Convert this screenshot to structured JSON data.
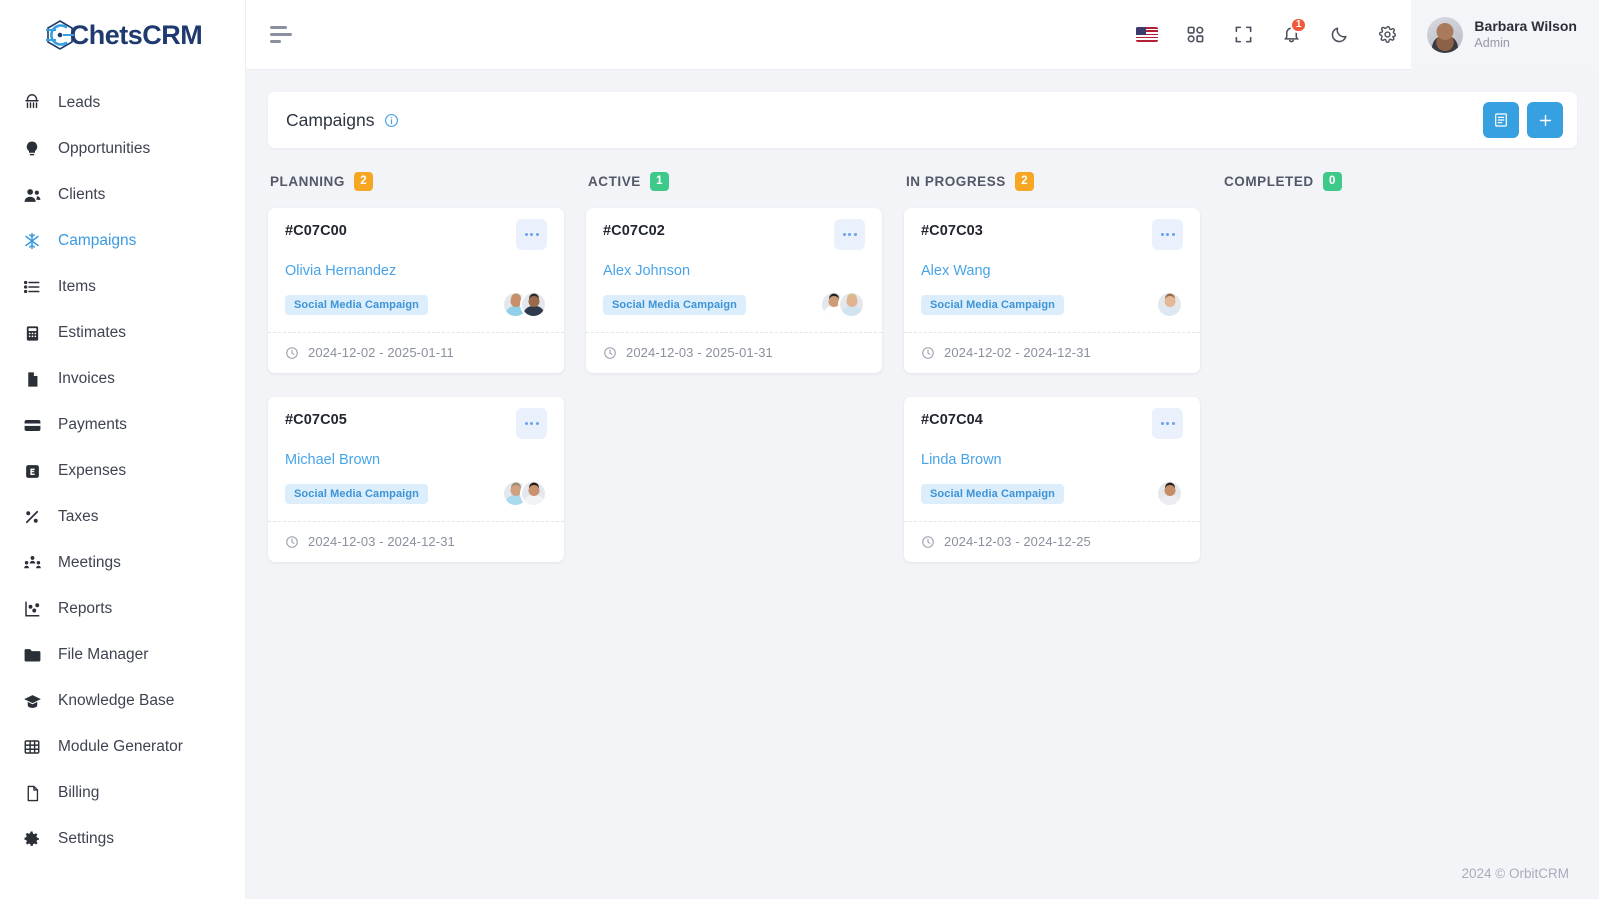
{
  "brand": {
    "name": "ChetsCRM",
    "logo_icon": "chets-logo-icon",
    "accent": "#36a0e0"
  },
  "sidebar": {
    "items": [
      {
        "label": "Leads",
        "icon": "leads-icon",
        "active": false
      },
      {
        "label": "Opportunities",
        "icon": "opportunities-icon",
        "active": false
      },
      {
        "label": "Clients",
        "icon": "clients-icon",
        "active": false
      },
      {
        "label": "Campaigns",
        "icon": "campaigns-icon",
        "active": true
      },
      {
        "label": "Items",
        "icon": "items-icon",
        "active": false
      },
      {
        "label": "Estimates",
        "icon": "estimates-icon",
        "active": false
      },
      {
        "label": "Invoices",
        "icon": "invoices-icon",
        "active": false
      },
      {
        "label": "Payments",
        "icon": "payments-icon",
        "active": false
      },
      {
        "label": "Expenses",
        "icon": "expenses-icon",
        "active": false
      },
      {
        "label": "Taxes",
        "icon": "taxes-icon",
        "active": false
      },
      {
        "label": "Meetings",
        "icon": "meetings-icon",
        "active": false
      },
      {
        "label": "Reports",
        "icon": "reports-icon",
        "active": false
      },
      {
        "label": "File Manager",
        "icon": "folder-icon",
        "active": false
      },
      {
        "label": "Knowledge Base",
        "icon": "graduation-cap-icon",
        "active": false
      },
      {
        "label": "Module Generator",
        "icon": "grid-table-icon",
        "active": false
      },
      {
        "label": "Billing",
        "icon": "billing-icon",
        "active": false
      },
      {
        "label": "Settings",
        "icon": "gear-icon",
        "active": false
      }
    ]
  },
  "topbar": {
    "menu_toggle_icon": "hamburger-icon",
    "language_flag": "us-flag-icon",
    "apps_icon": "apps-grid-icon",
    "fullscreen_icon": "fullscreen-icon",
    "notifications_icon": "bell-icon",
    "notifications_count": "1",
    "dark_mode_icon": "moon-icon",
    "settings_icon": "gear-icon",
    "user": {
      "name": "Barbara Wilson",
      "role": "Admin",
      "avatar": "user-avatar"
    }
  },
  "page": {
    "title": "Campaigns",
    "info_icon": "info-circle-icon",
    "actions": [
      {
        "name": "list-view-button",
        "icon": "list-view-icon",
        "glyph": "▤"
      },
      {
        "name": "add-campaign-button",
        "icon": "plus-icon",
        "glyph": "+"
      }
    ]
  },
  "board": {
    "columns": [
      {
        "title": "PLANNING",
        "count": "2",
        "count_color": "#f5a623",
        "cards": [
          {
            "id": "#C07C00",
            "person": "Olivia Hernandez",
            "tag": "Social Media Campaign",
            "date": "2024-12-02 - 2025-01-11",
            "menu_icon": "more-options-icon",
            "clock_icon": "clock-icon",
            "avatars": [
              {
                "name": "assignee-avatar",
                "skin": "#c98f6b",
                "hair": "#b9956c",
                "shirt": "#8fd0e8"
              },
              {
                "name": "assignee-avatar",
                "skin": "#9a6a4b",
                "hair": "#2d2a28",
                "shirt": "#2f3a4c"
              }
            ]
          },
          {
            "id": "#C07C05",
            "person": "Michael Brown",
            "tag": "Social Media Campaign",
            "date": "2024-12-03 - 2024-12-31",
            "menu_icon": "more-options-icon",
            "clock_icon": "clock-icon",
            "avatars": [
              {
                "name": "assignee-avatar",
                "skin": "#d0a181",
                "hair": "#9a8a78",
                "shirt": "#a8d9ee"
              },
              {
                "name": "assignee-avatar",
                "skin": "#c9926f",
                "hair": "#241c18",
                "shirt": "#f2f3f5"
              }
            ]
          }
        ]
      },
      {
        "title": "ACTIVE",
        "count": "1",
        "count_color": "#3ec98a",
        "cards": [
          {
            "id": "#C07C02",
            "person": "Alex Johnson",
            "tag": "Social Media Campaign",
            "date": "2024-12-03 - 2025-01-31",
            "menu_icon": "more-options-icon",
            "clock_icon": "clock-icon",
            "avatars": [
              {
                "name": "assignee-avatar",
                "skin": "#cd9b78",
                "hair": "#2b2320",
                "shirt": "#ffffff"
              },
              {
                "name": "assignee-avatar",
                "skin": "#e0b391",
                "hair": "#d9bd86",
                "shirt": "#cfe3f0"
              }
            ]
          }
        ]
      },
      {
        "title": "IN PROGRESS",
        "count": "2",
        "count_color": "#f5a623",
        "cards": [
          {
            "id": "#C07C03",
            "person": "Alex Wang",
            "tag": "Social Media Campaign",
            "date": "2024-12-02 - 2024-12-31",
            "menu_icon": "more-options-icon",
            "clock_icon": "clock-icon",
            "avatars": [
              {
                "name": "assignee-avatar",
                "skin": "#e4b795",
                "hair": "#9b6a42",
                "shirt": "#dde8f2"
              }
            ]
          },
          {
            "id": "#C07C04",
            "person": "Linda Brown",
            "tag": "Social Media Campaign",
            "date": "2024-12-03 - 2024-12-25",
            "menu_icon": "more-options-icon",
            "clock_icon": "clock-icon",
            "avatars": [
              {
                "name": "assignee-avatar",
                "skin": "#c68c66",
                "hair": "#2a211d",
                "shirt": "#ececf0"
              }
            ]
          }
        ]
      },
      {
        "title": "COMPLETED",
        "count": "0",
        "count_color": "#3ec98a",
        "cards": []
      }
    ]
  },
  "footer": {
    "text": "2024 © OrbitCRM"
  }
}
